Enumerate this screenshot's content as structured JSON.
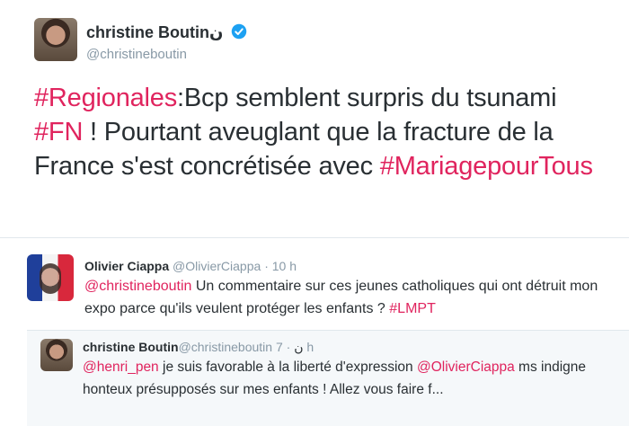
{
  "main": {
    "name": "christine Boutin",
    "name_suffix": "ن",
    "handle": "@christineboutin",
    "text": {
      "tag1": "#Regionales",
      "t1": ":Bcp semblent surpris du tsunami ",
      "tag2": "#FN",
      "t2": " ! Pourtant aveuglant que la fracture de la France s'est concrétisée avec ",
      "tag3": "#MariagepourTous"
    }
  },
  "reply1": {
    "name": "Olivier Ciappa",
    "handle": "@OlivierCiappa",
    "sep": "·",
    "time": "10 h",
    "mention": "@christineboutin",
    "t1": " Un commentaire sur ces jeunes catholiques qui ont détruit mon expo parce qu'ils veulent protéger les enfants ? ",
    "tag": "#LMPT"
  },
  "reply2": {
    "name": "christine Boutin",
    "handle": "@christineboutin",
    "name_suffix": "ن",
    "sep": "·",
    "time": "7 h",
    "mention1": "@henri_pen",
    "t1": " je suis favorable à la liberté d'expression ",
    "mention2": "@OlivierCiappa",
    "t2": " ms indigne honteux présupposés sur mes enfants ! Allez vous faire f..."
  },
  "colors": {
    "accent": "#e0245e",
    "verified": "#1da1f2",
    "meta": "#8899a6"
  }
}
